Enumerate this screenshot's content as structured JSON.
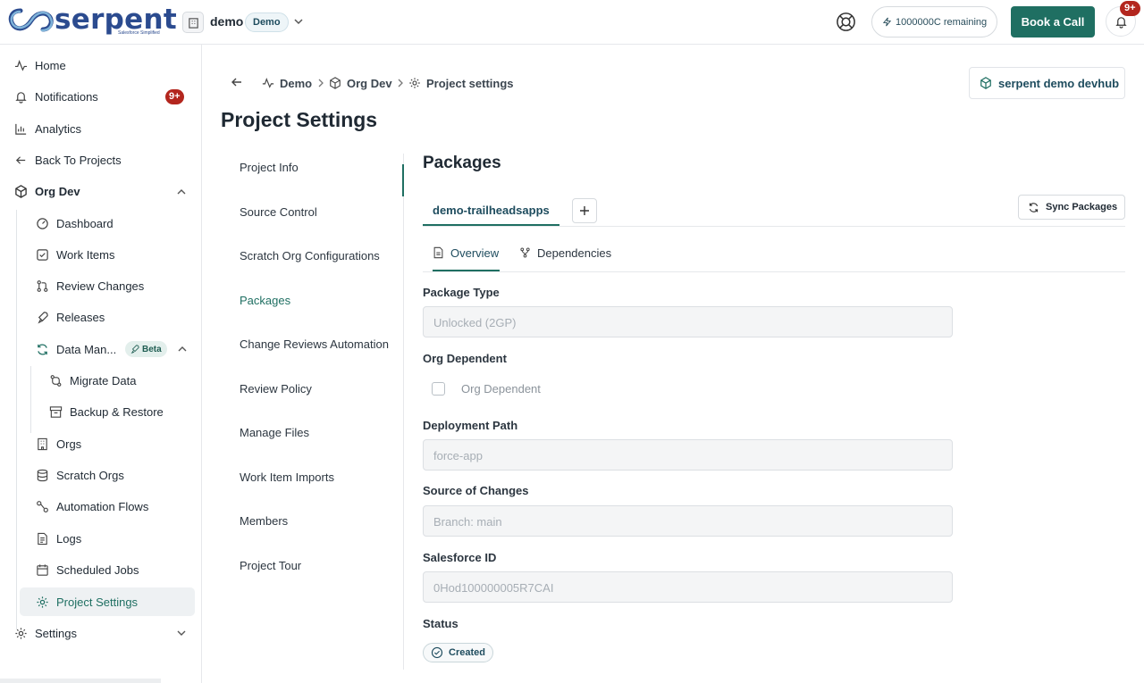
{
  "brand": {
    "name": "serpent",
    "tagline": "Salesforce Simplified",
    "color": "#2b4b8f"
  },
  "header": {
    "workspace_name": "demo",
    "workspace_badge": "Demo",
    "credits": "1000000C remaining",
    "book_call": "Book a Call",
    "notif_badge": "9+"
  },
  "sidebar": {
    "home": "Home",
    "notifications": "Notifications",
    "notifications_badge": "9+",
    "analytics": "Analytics",
    "back": "Back To Projects",
    "org": "Org Dev",
    "dashboard": "Dashboard",
    "work_items": "Work Items",
    "review_changes": "Review Changes",
    "releases": "Releases",
    "data_management": "Data Man...",
    "beta": "Beta",
    "migrate_data": "Migrate Data",
    "backup_restore": "Backup & Restore",
    "orgs": "Orgs",
    "scratch_orgs": "Scratch Orgs",
    "automation_flows": "Automation Flows",
    "logs": "Logs",
    "scheduled_jobs": "Scheduled Jobs",
    "project_settings": "Project Settings",
    "settings": "Settings"
  },
  "breadcrumb": {
    "demo": "Demo",
    "org": "Org Dev",
    "current": "Project settings"
  },
  "org_button": "serpent demo devhub",
  "page_title": "Project Settings",
  "settings_nav": [
    "Project Info",
    "Source Control",
    "Scratch Org Configurations",
    "Packages",
    "Change Reviews Automation",
    "Review Policy",
    "Manage Files",
    "Work Item Imports",
    "Members",
    "Project Tour"
  ],
  "packages": {
    "title": "Packages",
    "tab": "demo-trailheadsapps",
    "sync": "Sync Packages",
    "subtabs": {
      "overview": "Overview",
      "dependencies": "Dependencies"
    },
    "fields": {
      "package_type_label": "Package Type",
      "package_type_value": "Unlocked (2GP)",
      "org_dependent_label": "Org Dependent",
      "org_dependent_checkbox": "Org Dependent",
      "deployment_path_label": "Deployment Path",
      "deployment_path_value": "force-app",
      "source_label": "Source of Changes",
      "source_value": "Branch: main",
      "sfid_label": "Salesforce ID",
      "sfid_value": "0Hod100000005R7CAI",
      "status_label": "Status",
      "status_value": "Created"
    }
  },
  "colors": {
    "accent": "#1f6f62",
    "danger": "#b3261e",
    "text": "#1f2933"
  }
}
